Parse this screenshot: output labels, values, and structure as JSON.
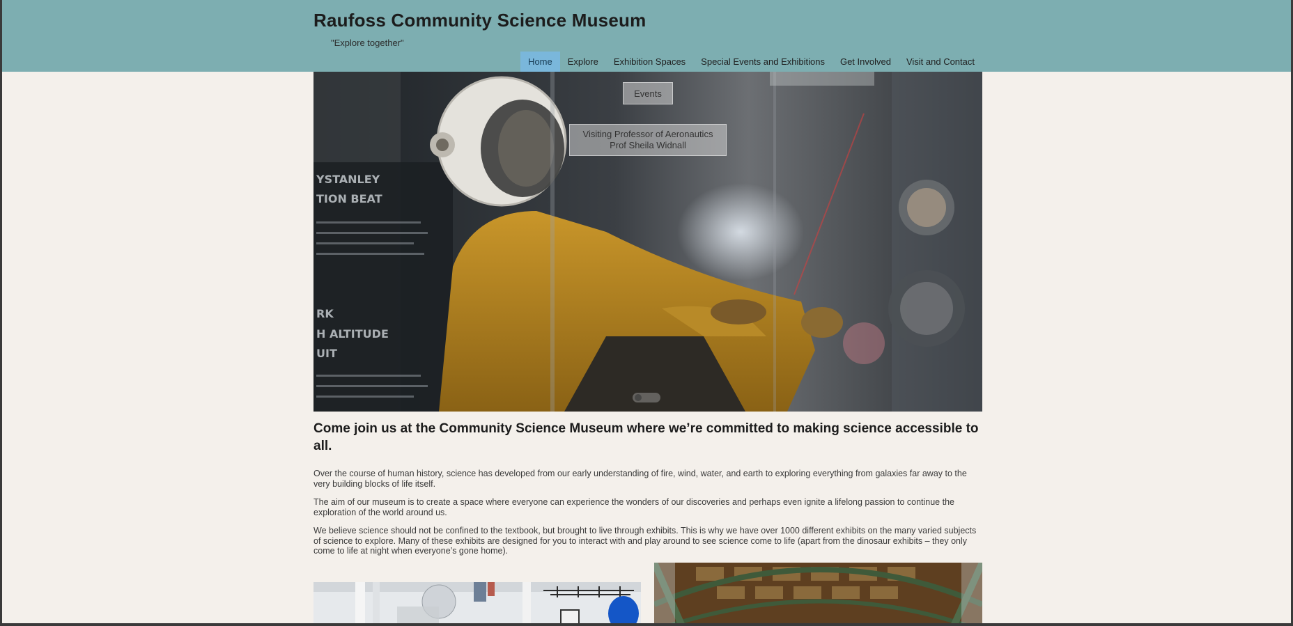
{
  "site": {
    "title": "Raufoss Community Science Museum",
    "tagline": "\"Explore together\""
  },
  "nav": {
    "items": [
      {
        "label": "Home",
        "active": true
      },
      {
        "label": "Explore"
      },
      {
        "label": "Exhibition Spaces"
      },
      {
        "label": "Special Events and Exhibitions"
      },
      {
        "label": "Get Involved"
      },
      {
        "label": "Visit and Contact"
      }
    ]
  },
  "hero": {
    "badge": "Events",
    "caption_line1": "Visiting Professor of Aeronautics",
    "caption_line2": "Prof Sheila Widnall"
  },
  "main": {
    "lead": "Come join us at the Community Science Museum where we’re committed to making science accessible to all.",
    "paragraphs": [
      "Over the course of human history, science has developed from our early understanding of fire, wind, water, and earth to exploring everything from galaxies far away to the very building blocks of life itself.",
      "The aim of our museum is to create a space where everyone can experience the wonders of our discoveries and perhaps even ignite a lifelong passion to continue the exploration of the world around us.",
      "We believe science should not be confined to the textbook, but brought to live through exhibits. This is why we have over 1000 different exhibits on the many varied subjects of science to explore. Many of these exhibits are designed for you to interact with and play around to see science come to life (apart from the dinosaur exhibits – they only come to life at night when everyone’s gone home)."
    ]
  },
  "colors": {
    "header_bg": "#7daeb1",
    "nav_active_bg": "#7ab7db",
    "page_bg": "#f4f0eb"
  }
}
